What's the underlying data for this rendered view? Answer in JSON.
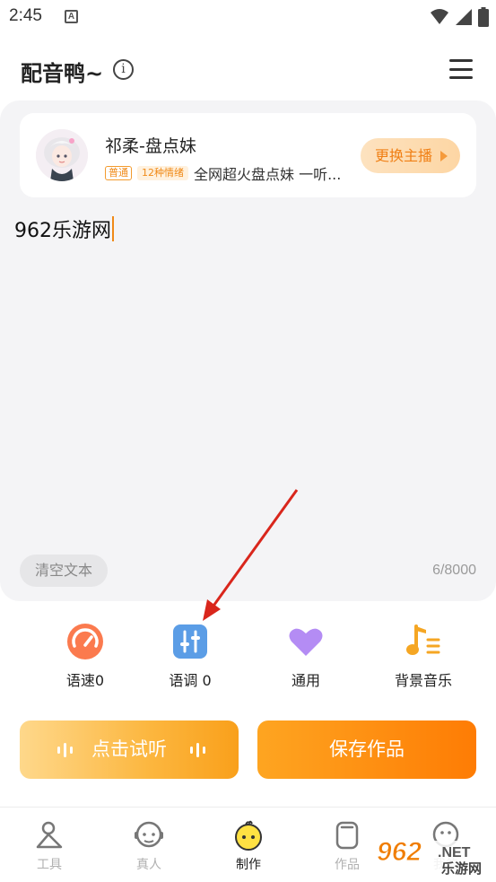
{
  "status_bar": {
    "time": "2:45",
    "notification_letter": "A"
  },
  "header": {
    "title": "配音鸭~",
    "info_glyph": "i"
  },
  "voice_card": {
    "name": "祁柔-盘点妹",
    "tag_normal": "普通",
    "tag_emotion": "12种情绪",
    "description": "全网超火盘点妹 一听...",
    "switch_label": "更换主播"
  },
  "editor": {
    "text": "962乐游网",
    "clear_label": "清空文本",
    "char_count": "6/8000"
  },
  "tools": [
    {
      "label": "语速0",
      "icon": "speedometer-icon",
      "color": "#fb7a4e"
    },
    {
      "label": "语调 0",
      "icon": "tone-sliders-icon",
      "color": "#5b9de6"
    },
    {
      "label": "通用",
      "icon": "heart-icon",
      "color": "#b48cf4"
    },
    {
      "label": "背景音乐",
      "icon": "music-note-icon",
      "color": "#f5a623"
    }
  ],
  "actions": {
    "preview_label": "点击试听",
    "save_label": "保存作品"
  },
  "bottom_nav": [
    {
      "label": "工具",
      "icon": "tools-icon",
      "active": false
    },
    {
      "label": "真人",
      "icon": "person-face-icon",
      "active": false
    },
    {
      "label": "制作",
      "icon": "duck-icon",
      "active": true
    },
    {
      "label": "作品",
      "icon": "works-icon",
      "active": false
    },
    {
      "label": "我的",
      "icon": "profile-icon",
      "active": false
    }
  ],
  "watermark": {
    "number": "962",
    "suffix": ".NET",
    "text": "乐游网"
  },
  "colors": {
    "accent": "#fe8a0e",
    "panel_bg": "#f4f4f6"
  }
}
